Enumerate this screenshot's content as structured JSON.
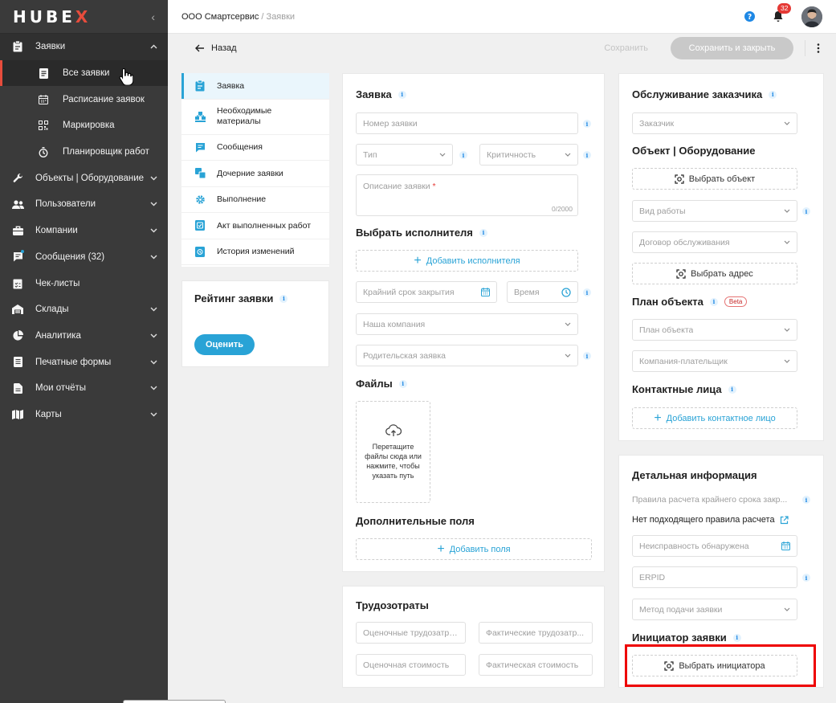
{
  "app": {
    "logo_a": "HUB",
    "logo_b": "E",
    "logo_c": "X"
  },
  "sidebar": {
    "items": [
      {
        "label": "Заявки",
        "icon": "clipboard-icon",
        "expanded": true
      },
      {
        "label": "Все заявки",
        "icon": "list-doc-icon",
        "active": true
      },
      {
        "label": "Расписание заявок",
        "icon": "calendar-icon"
      },
      {
        "label": "Маркировка",
        "icon": "qr-code-icon"
      },
      {
        "label": "Планировщик работ",
        "icon": "timer-icon"
      },
      {
        "label": "Объекты | Оборудование",
        "icon": "wrench-icon"
      },
      {
        "label": "Пользователи",
        "icon": "users-icon"
      },
      {
        "label": "Компании",
        "icon": "briefcase-icon"
      },
      {
        "label": "Сообщения (32)",
        "icon": "chat-icon"
      },
      {
        "label": "Чек-листы",
        "icon": "checklist-icon"
      },
      {
        "label": "Склады",
        "icon": "warehouse-icon"
      },
      {
        "label": "Аналитика",
        "icon": "pie-chart-icon"
      },
      {
        "label": "Печатные формы",
        "icon": "print-form-icon"
      },
      {
        "label": "Мои отчёты",
        "icon": "report-icon"
      },
      {
        "label": "Карты",
        "icon": "map-icon"
      }
    ]
  },
  "topbar": {
    "company": "ООО Смартсервис",
    "separator": " / ",
    "page": "Заявки",
    "notifications": "32"
  },
  "actions": {
    "back": "Назад",
    "save": "Сохранить",
    "save_close": "Сохранить и закрыть"
  },
  "tabs": [
    {
      "label": "Заявка",
      "icon": "clipboard-icon"
    },
    {
      "label": "Необходимые материалы",
      "icon": "materials-icon"
    },
    {
      "label": "Сообщения",
      "icon": "chat-icon"
    },
    {
      "label": "Дочерние заявки",
      "icon": "child-requests-icon"
    },
    {
      "label": "Выполнение",
      "icon": "gear-icon"
    },
    {
      "label": "Акт выполненных работ",
      "icon": "act-icon"
    },
    {
      "label": "История изменений",
      "icon": "history-icon"
    }
  ],
  "rating": {
    "title": "Рейтинг заявки",
    "button": "Оценить"
  },
  "request": {
    "title": "Заявка",
    "number_ph": "Номер заявки",
    "type_ph": "Тип",
    "criticality_ph": "Критичность",
    "description_ph": "Описание заявки",
    "required_mark": "*",
    "counter": "0/2000",
    "executor_title": "Выбрать исполнителя",
    "add_executor": "Добавить исполнителя",
    "deadline_ph": "Крайний срок закрытия",
    "time_ph": "Время",
    "company_ph": "Наша компания",
    "parent_ph": "Родительская заявка",
    "files_title": "Файлы",
    "upload_text": "Перетащите файлы сюда или нажмите, чтобы указать путь",
    "extra_title": "Дополнительные поля",
    "add_field": "Добавить поля"
  },
  "labor": {
    "title": "Трудозотраты",
    "est_labor": "Оценочные трудозатра...",
    "fact_labor": "Фактические трудозатр...",
    "est_cost": "Оценочная стоимость",
    "fact_cost": "Фактическая стоимость"
  },
  "customer": {
    "title": "Обслуживание заказчика",
    "customer_ph": "Заказчик",
    "object_title": "Объект | Оборудование",
    "select_object": "Выбрать объект",
    "work_type_ph": "Вид работы",
    "contract_ph": "Договор обслуживания",
    "select_address": "Выбрать адрес",
    "plan_title": "План объекта",
    "beta": "Beta",
    "plan_ph": "План объекта",
    "payer_ph": "Компания-плательщик",
    "contacts_title": "Контактные лица",
    "add_contact": "Добавить контактное лицо"
  },
  "details": {
    "title": "Детальная информация",
    "rules_ph": "Правила расчета крайнего срока закр...",
    "no_rule": "Нет подходящего правила расчета",
    "fault_ph": "Неисправность обнаружена",
    "erpid_ph": "ERPID",
    "method_ph": "Метод подачи заявки",
    "initiator_title": "Инициатор заявки",
    "select_initiator": "Выбрать инициатора"
  },
  "colors": {
    "accent": "#29a3d6",
    "sidebar": "#3a3a3a",
    "danger": "#e53935",
    "highlight": "#ee0000"
  }
}
